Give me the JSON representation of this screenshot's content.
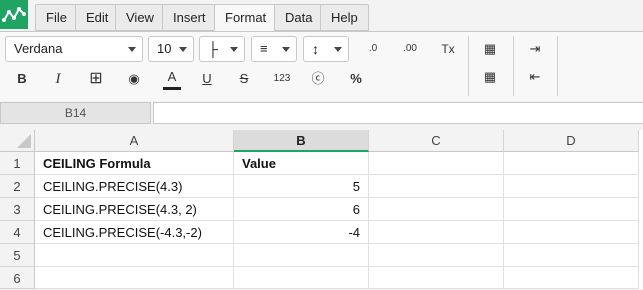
{
  "menu": {
    "items": [
      "File",
      "Edit",
      "View",
      "Insert",
      "Format",
      "Data",
      "Help"
    ],
    "active": "Format"
  },
  "toolbar": {
    "font_family": "Verdana",
    "font_size": "10",
    "number_format_label": "123",
    "percent_label": "%",
    "bold_label": "B",
    "italic_label": "I",
    "underline_label": "U",
    "strike_label": "S",
    "text_color_label": "A",
    "clear_format_label": "Tx",
    "dec_decrease_label": ".0",
    "dec_increase_label": ".00"
  },
  "formula_bar": {
    "cell_ref": "B14",
    "value": ""
  },
  "grid": {
    "columns": [
      "A",
      "B",
      "C",
      "D"
    ],
    "selected_column": "B",
    "rows": [
      {
        "num": "1",
        "a": "CEILING Formula",
        "b": "Value"
      },
      {
        "num": "2",
        "a": "CEILING.PRECISE(4.3)",
        "b": "5"
      },
      {
        "num": "3",
        "a": "CEILING.PRECISE(4.3, 2)",
        "b": "6"
      },
      {
        "num": "4",
        "a": "CEILING.PRECISE(-4.3,-2)",
        "b": "-4"
      },
      {
        "num": "5",
        "a": "",
        "b": ""
      },
      {
        "num": "6",
        "a": "",
        "b": ""
      }
    ]
  },
  "colors": {
    "accent": "#1fa463",
    "header_bg": "#f3f3f3"
  }
}
